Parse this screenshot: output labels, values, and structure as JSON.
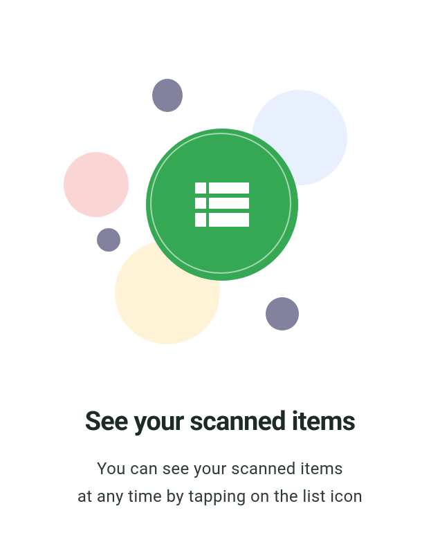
{
  "onboarding": {
    "title": "See your scanned items",
    "description_lines": [
      "You can see your scanned items",
      "at any time by tapping on the list icon"
    ],
    "icon": "list-icon"
  },
  "colors": {
    "primary_green": "#34a853",
    "dot": "#82829e",
    "blue_tint": "#e8f0fe",
    "pink_tint": "#f9d5d4",
    "yellow_tint": "#fef3d6",
    "title_text": "#1c2b27",
    "body_text": "#2f3a38"
  }
}
